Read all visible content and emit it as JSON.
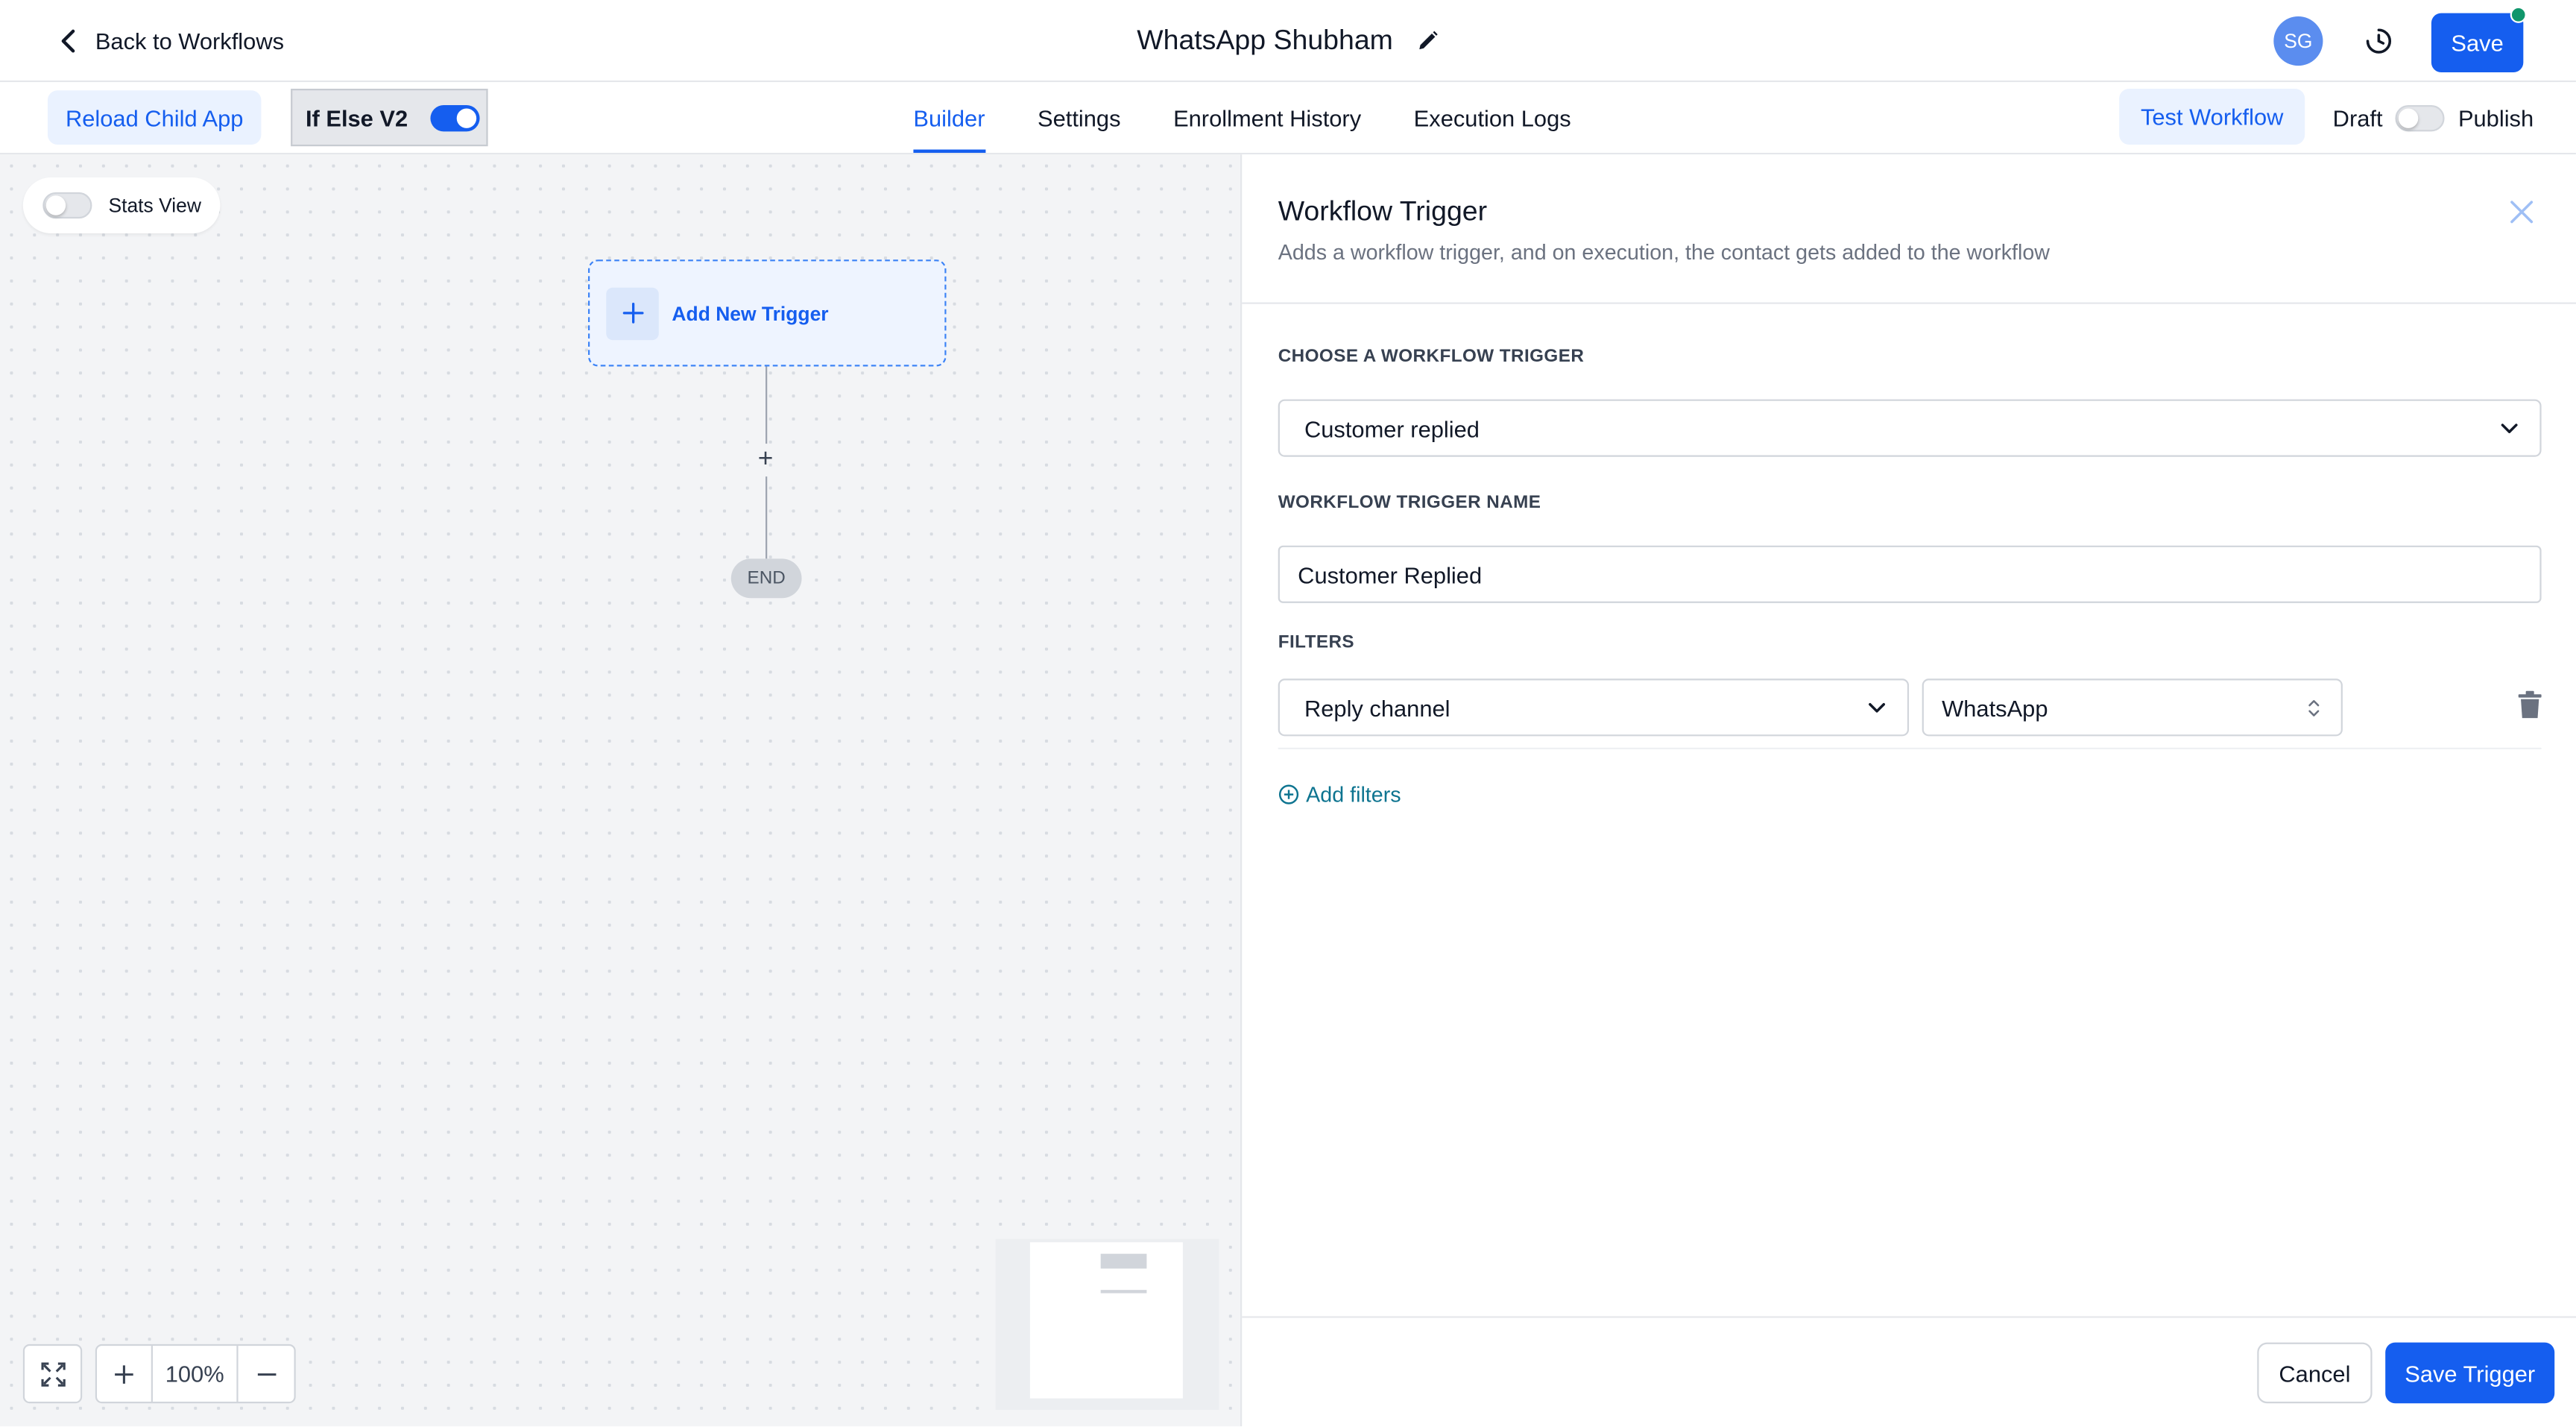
{
  "header": {
    "back_label": "Back to Workflows",
    "workflow_title": "WhatsApp Shubham",
    "avatar_initials": "SG",
    "save_label": "Save",
    "status_dot_color": "#10966b"
  },
  "subbar": {
    "reload_label": "Reload Child App",
    "ifelse_label": "If Else V2",
    "ifelse_enabled": true,
    "tabs": [
      {
        "label": "Builder",
        "active": true
      },
      {
        "label": "Settings",
        "active": false
      },
      {
        "label": "Enrollment History",
        "active": false
      },
      {
        "label": "Execution Logs",
        "active": false
      }
    ],
    "test_label": "Test Workflow",
    "draft_label": "Draft",
    "publish_label": "Publish",
    "published": false
  },
  "canvas": {
    "stats_label": "Stats View",
    "stats_enabled": false,
    "trigger_label": "Add New Trigger",
    "add_step_glyph": "+",
    "end_label": "END",
    "zoom_level": "100%"
  },
  "panel": {
    "title": "Workflow Trigger",
    "subtitle": "Adds a workflow trigger, and on execution, the contact gets added to the workflow",
    "trigger_section_label": "CHOOSE A WORKFLOW TRIGGER",
    "trigger_value": "Customer replied",
    "name_section_label": "WORKFLOW TRIGGER NAME",
    "name_value": "Customer Replied",
    "filters_label": "FILTERS",
    "filters": [
      {
        "field": "Reply channel",
        "value": "WhatsApp"
      }
    ],
    "add_filters_label": "Add filters",
    "cancel_label": "Cancel",
    "save_trigger_label": "Save Trigger"
  },
  "colors": {
    "accent": "#155eef",
    "accent_light": "#eaf2ff",
    "link_teal": "#0e7490"
  },
  "icons": [
    "chevron-left-icon",
    "pencil-icon",
    "history-icon",
    "close-icon",
    "chevron-down-icon",
    "sort-arrows-icon",
    "trash-icon",
    "plus-circle-icon",
    "fit-view-icon",
    "plus-icon",
    "minus-icon"
  ]
}
